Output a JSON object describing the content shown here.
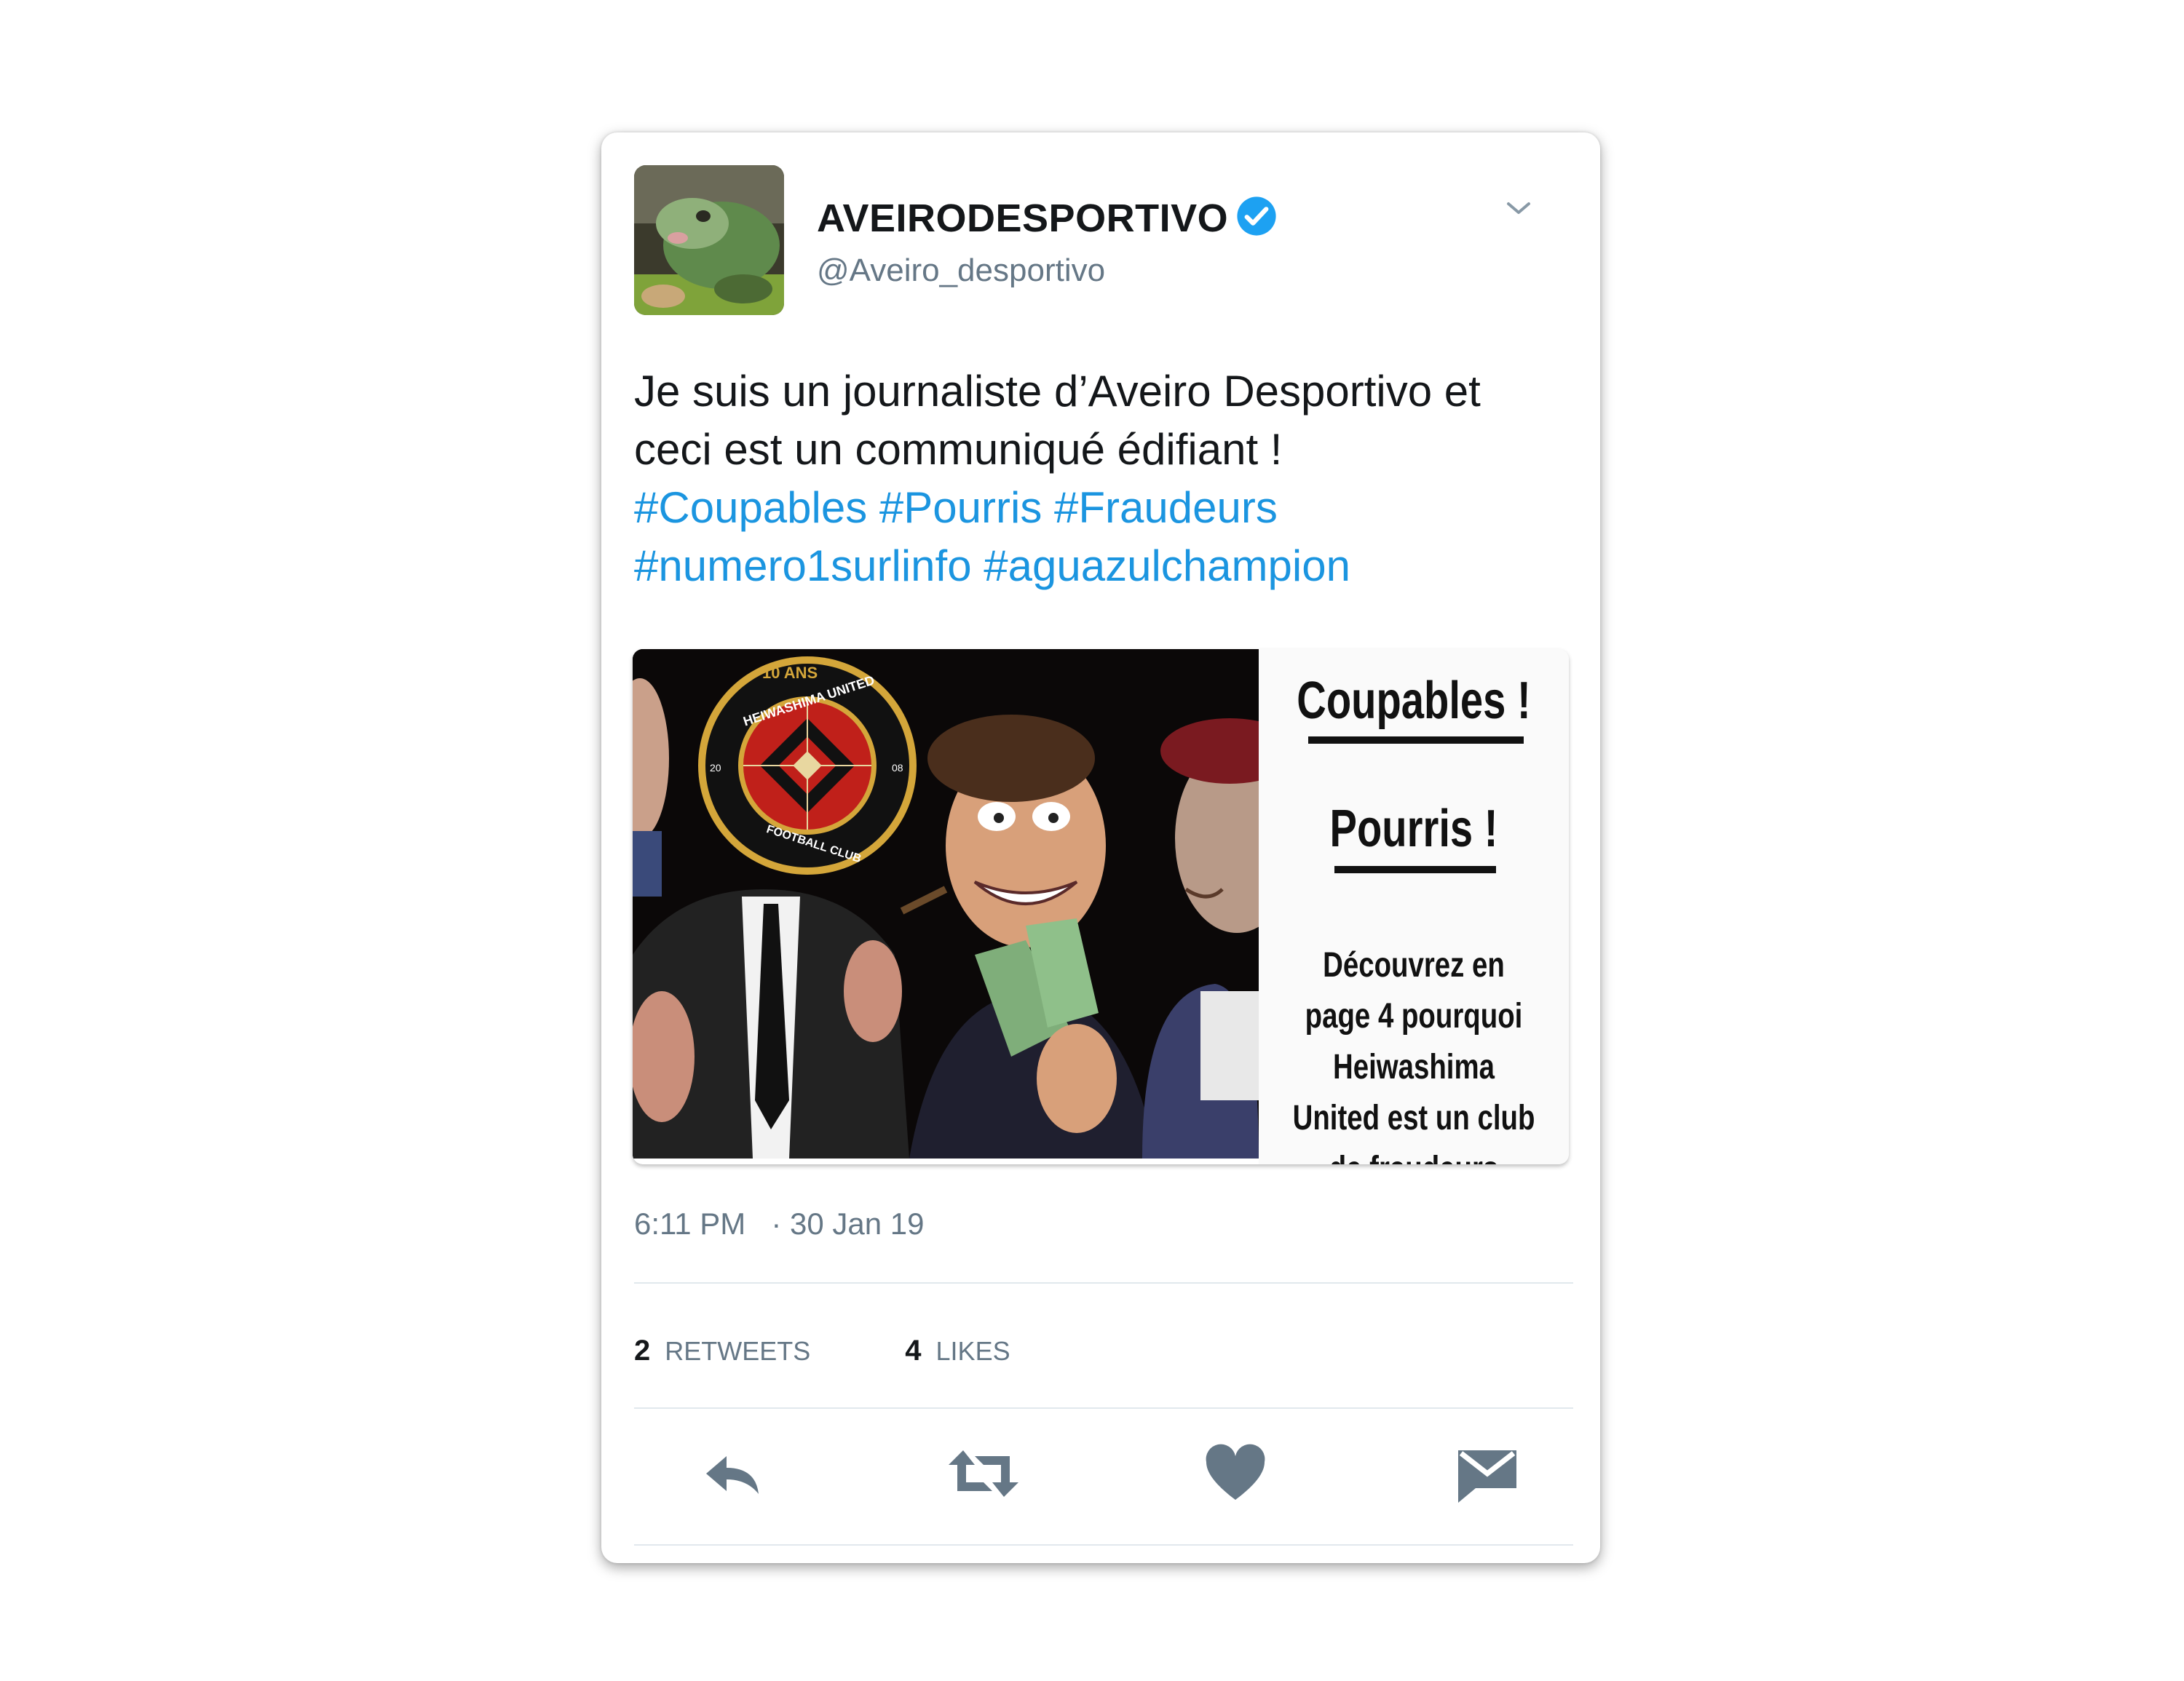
{
  "tweet": {
    "display_name": "AVEIRODESPORTIVO",
    "handle": "@Aveiro_desportivo",
    "text_line1": "Je suis un journaliste d’Aveiro Desportivo et",
    "text_line2": "ceci est un communiqué édifiant !",
    "hashtags_line1": [
      "#Coupables",
      "#Pourris",
      "#Fraudeurs"
    ],
    "hashtags_line2": [
      "#numero1surlinfo",
      "#aguazulchampion"
    ],
    "time": "6:11 PM",
    "date": "· 30 Jan 19",
    "retweets_count": "2",
    "retweets_label": "RETWEETS",
    "likes_count": "4",
    "likes_label": "LIKES"
  },
  "media": {
    "headline_1": "Coupables !",
    "headline_2": "Pourris !",
    "body": "Découvrez en page 4 pourquoi Heiwashima United est un club de fraudeurs",
    "badge_top": "10 ANS",
    "badge_name": "HEIWASHIMA UNITED",
    "badge_bottom": "FOOTBALL CLUB",
    "badge_year_left": "20",
    "badge_year_right": "08"
  },
  "colors": {
    "accent": "#1b95e0",
    "verified": "#1da1f2",
    "secondary_text": "#657786",
    "icon": "#657786"
  },
  "icons": [
    "chevron-down-icon",
    "verified-badge-icon",
    "reply-icon",
    "retweet-icon",
    "like-icon",
    "message-icon"
  ]
}
